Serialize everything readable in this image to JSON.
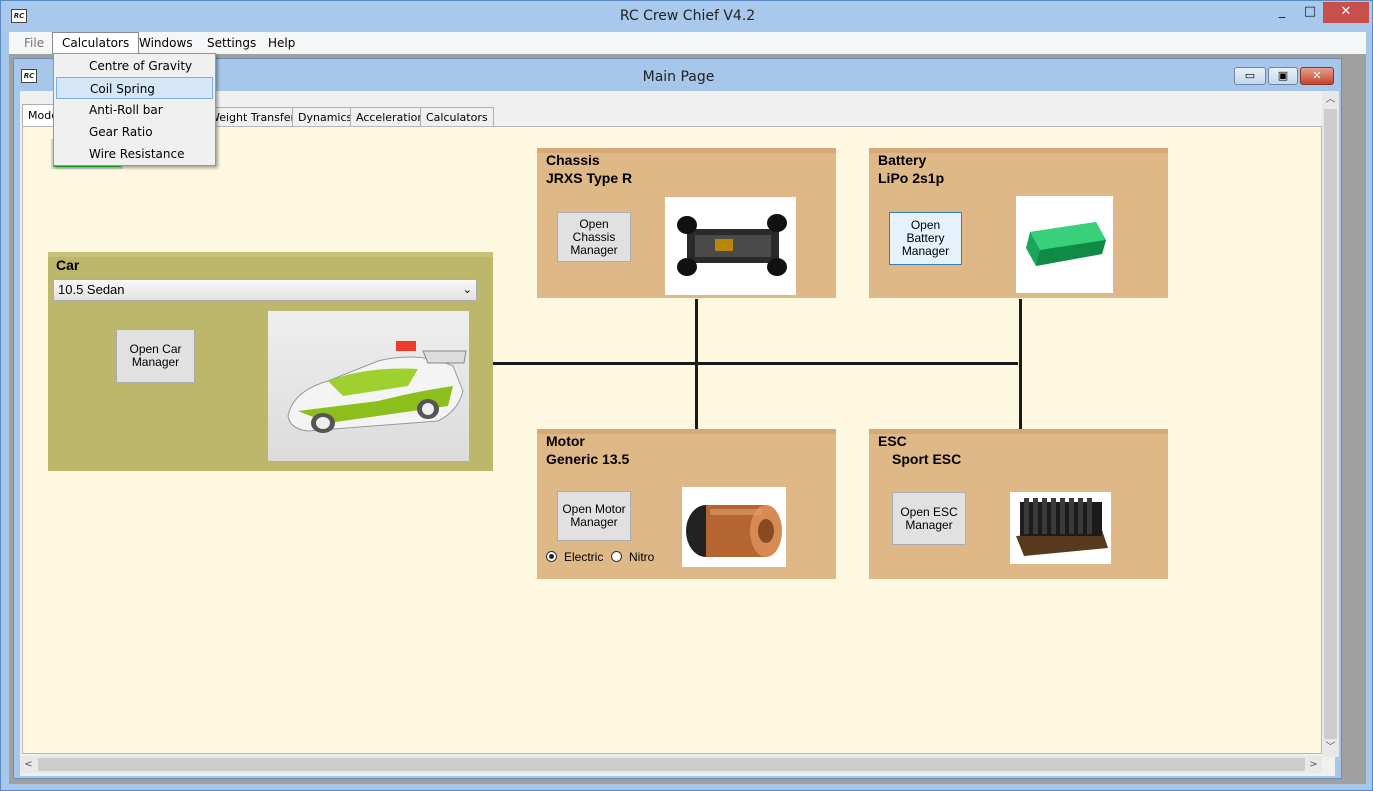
{
  "app": {
    "title": "RC Crew Chief V4.2",
    "logo_text": "RC"
  },
  "window_buttons": {
    "minimize": "_",
    "maximize": "□",
    "close": "✕"
  },
  "menubar": [
    {
      "label": "File"
    },
    {
      "label": "Calculators"
    },
    {
      "label": "Windows"
    },
    {
      "label": "Settings"
    },
    {
      "label": "Help"
    }
  ],
  "calculators_menu": [
    "Centre of Gravity",
    "Coil Spring",
    "Anti-Roll bar",
    "Gear Ratio",
    "Wire Resistance"
  ],
  "child": {
    "title": "Main Page",
    "logo_text": "RC"
  },
  "tabs": [
    "Model",
    "Weight Transfer",
    "Dynamics",
    "Acceleration",
    "Calculators"
  ],
  "car": {
    "title": "Car",
    "selected": "10.5 Sedan",
    "open_button": "Open Car Manager"
  },
  "chassis": {
    "title": "Chassis",
    "name": "JRXS Type R",
    "open_button": "Open Chassis Manager"
  },
  "battery": {
    "title": "Battery",
    "name": "LiPo 2s1p",
    "open_button": "Open Battery Manager"
  },
  "motor": {
    "title": "Motor",
    "name": "Generic 13.5",
    "open_button": "Open Motor Manager",
    "radio_electric": "Electric",
    "radio_nitro": "Nitro",
    "selected": "Electric"
  },
  "esc": {
    "title": "ESC",
    "name": "Sport ESC",
    "open_button": "Open ESC Manager"
  },
  "colors": {
    "tan_panel": "#deb887",
    "olive_panel": "#bdb76b",
    "tab_page_bg": "#fff8e0",
    "status_green": "#22cc22"
  },
  "icons": [
    "chevron-down-icon",
    "scroll-up-icon",
    "scroll-down-icon",
    "scroll-left-icon",
    "scroll-right-icon"
  ]
}
